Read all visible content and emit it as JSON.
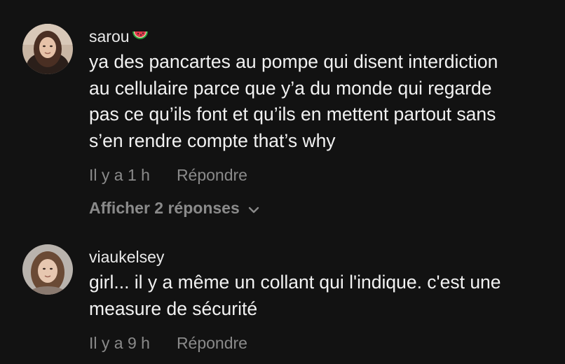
{
  "comments": [
    {
      "username": "sarou",
      "username_emoji": "watermelon",
      "text": "ya des pancartes au pompe qui disent interdiction\nau cellulaire parce que y’a du monde qui regarde\npas ce qu’ils font et qu’ils en mettent partout sans\ns’en rendre compte that’s why",
      "time": "Il y a 1 h",
      "reply_label": "Répondre",
      "show_replies_label": "Afficher 2 réponses"
    },
    {
      "username": "viaukelsey",
      "text": "girl... il y a même un collant qui l'indique. c'est une\nmeasure de sécurité",
      "time": "Il y a 9 h",
      "reply_label": "Répondre"
    }
  ],
  "icons": {
    "show_replies_chevron": "chevron-down-icon",
    "username_emoji": "watermelon-icon"
  },
  "colors": {
    "background": "#121212",
    "primary_text": "#f2f2f2",
    "secondary_text": "#8a8a8a"
  }
}
